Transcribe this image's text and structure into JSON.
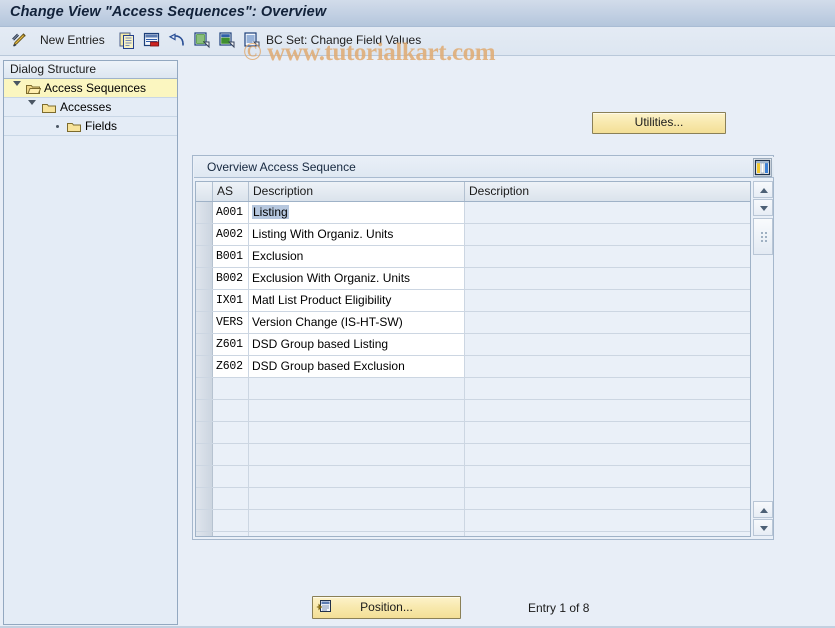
{
  "window": {
    "title": "Change View \"Access Sequences\": Overview"
  },
  "watermark": {
    "text": "© www.tutorialkart.com",
    "color": "#e0ab72"
  },
  "toolbar": {
    "edit_icon": "pencil-display-change-icon",
    "new_entries_label": "New Entries",
    "icons": [
      {
        "name": "copy-as-icon",
        "title": "Copy As..."
      },
      {
        "name": "delete-row-icon",
        "title": "Delete"
      },
      {
        "name": "undo-icon",
        "title": "Undo Change"
      },
      {
        "name": "select-all-icon",
        "title": "Select All"
      },
      {
        "name": "deselect-all-icon",
        "title": "Deselect All"
      },
      {
        "name": "details-icon",
        "title": "Details"
      }
    ],
    "bc_set_label": "BC Set: Change Field Values"
  },
  "sidebar": {
    "header": "Dialog Structure",
    "items": [
      {
        "label": "Access Sequences",
        "level": 0,
        "selected": true,
        "expander": "triangle-down",
        "icon": "open-folder-icon"
      },
      {
        "label": "Accesses",
        "level": 1,
        "selected": false,
        "expander": "triangle-down",
        "icon": "folder-icon"
      },
      {
        "label": "Fields",
        "level": 2,
        "selected": false,
        "expander": "dot",
        "icon": "folder-icon"
      }
    ]
  },
  "main": {
    "utilities_button": "Utilities...",
    "group_title": "Overview Access Sequence",
    "table": {
      "columns": [
        "AS",
        "Description",
        "Description"
      ],
      "rows": [
        {
          "as": "A001",
          "desc": "Listing",
          "desc2": "",
          "selected": true
        },
        {
          "as": "A002",
          "desc": "Listing With Organiz. Units",
          "desc2": "",
          "selected": false
        },
        {
          "as": "B001",
          "desc": "Exclusion",
          "desc2": "",
          "selected": false
        },
        {
          "as": "B002",
          "desc": "Exclusion With Organiz. Units",
          "desc2": "",
          "selected": false
        },
        {
          "as": "IX01",
          "desc": "Matl List Product Eligibility",
          "desc2": "",
          "selected": false
        },
        {
          "as": "VERS",
          "desc": "Version Change (IS-HT-SW)",
          "desc2": "",
          "selected": false
        },
        {
          "as": "Z601",
          "desc": "DSD Group based Listing",
          "desc2": "",
          "selected": false
        },
        {
          "as": "Z602",
          "desc": "DSD Group based Exclusion",
          "desc2": "",
          "selected": false
        }
      ],
      "empty_row_count": 8,
      "column_config_icon": "column-configuration-icon"
    },
    "scrollbar": {
      "up_icon": "scroll-up-icon",
      "down_icon": "scroll-down-icon",
      "thumb_grip_icon": "scroll-thumb-grip-icon",
      "page_up_icon": "page-up-icon",
      "page_down_icon": "page-down-icon"
    }
  },
  "footer": {
    "position_button": "Position...",
    "position_icon": "position-icon",
    "entry_status": "Entry 1 of 8"
  },
  "colors": {
    "title_bar": "#c2d0e3",
    "app_background": "#e8eef7",
    "button_yellow": "#f8e9ae",
    "tree_selection": "#fbf6c0",
    "cell_selection": "#b6c7de"
  }
}
